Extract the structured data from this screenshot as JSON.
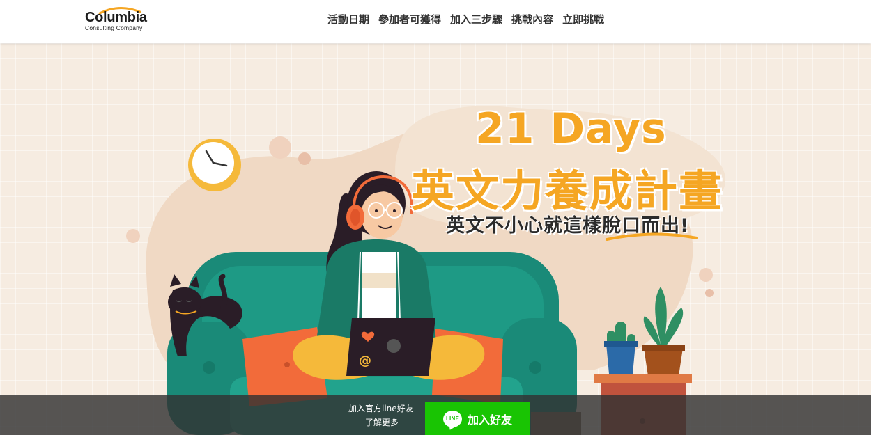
{
  "brand": {
    "name": "Columbia",
    "subtitle": "Consulting Company"
  },
  "nav": {
    "items": [
      {
        "label": "活動日期"
      },
      {
        "label": "參加者可獲得"
      },
      {
        "label": "加入三步驟"
      },
      {
        "label": "挑戰內容"
      },
      {
        "label": "立即挑戰"
      }
    ]
  },
  "hero": {
    "title_en": "21 Days",
    "title_zh": "英文力養成計畫",
    "subtitle": "英文不小心就這樣脫口而出!"
  },
  "bottom_bar": {
    "line_text": "加入官方line好友",
    "learn_more": "了解更多",
    "button_label": "加入好友",
    "line_logo_text": "LINE"
  },
  "colors": {
    "accent": "#f5a623",
    "line_green": "#19c403",
    "sofa": "#1a8a78",
    "background": "#f6ece1"
  }
}
